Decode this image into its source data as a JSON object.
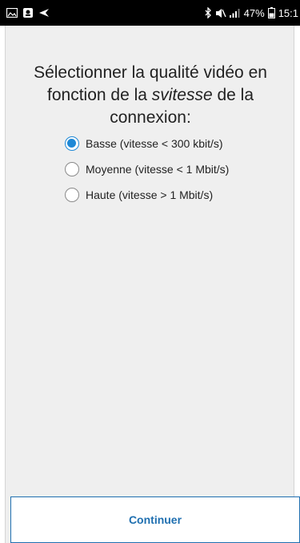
{
  "status_bar": {
    "icons_left": [
      "gallery-icon",
      "notification-icon",
      "navigation-icon"
    ],
    "icons_right": [
      "bluetooth-icon",
      "mute-icon",
      "signal-icon",
      "battery-icon"
    ],
    "battery": "47%",
    "time": "15:1"
  },
  "question": {
    "text_before": "Sélectionner la qualité vidéo en fonction de la ",
    "text_italic": "svitesse",
    "text_after": " de la connexion:"
  },
  "options": [
    {
      "label": "Basse (vitesse < 300 kbit/s)",
      "selected": true
    },
    {
      "label": "Moyenne (vitesse < 1 Mbit/s)",
      "selected": false
    },
    {
      "label": "Haute (vitesse > 1 Mbit/s)",
      "selected": false
    }
  ],
  "continue_button": {
    "label": "Continuer"
  },
  "colors": {
    "accent": "#1e88d6",
    "button_text": "#1f6fb0",
    "panel_bg": "#efefef",
    "status_bg": "#000000"
  }
}
